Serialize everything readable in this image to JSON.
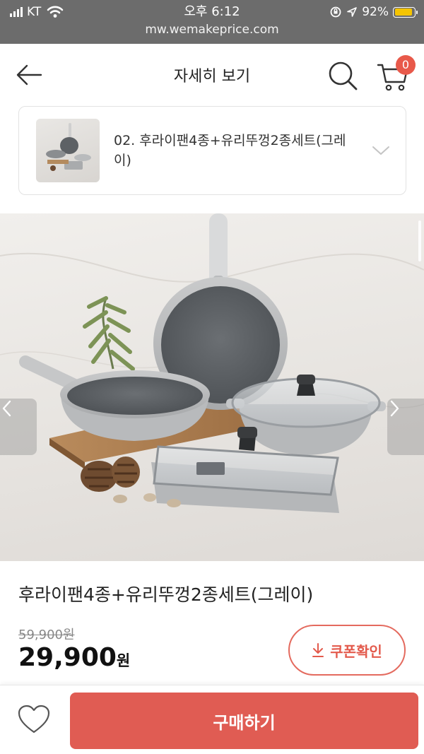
{
  "status_bar": {
    "carrier": "KT",
    "time": "오후 6:12",
    "battery": "92%",
    "url": "mw.wemakeprice.com"
  },
  "header": {
    "title": "자세히 보기",
    "cart_count": "0"
  },
  "option": {
    "label": "02. 후라이팬4종+유리뚜껑2종세트(그레이)"
  },
  "product": {
    "name": "후라이팬4종+유리뚜껑2종세트(그레이)",
    "original_price": "59,900원",
    "sale_price": "29,900",
    "sale_currency": "원",
    "coupon_label": "쿠폰확인"
  },
  "bottom_bar": {
    "buy_label": "구매하기"
  },
  "colors": {
    "accent": "#e05c53",
    "coupon_text": "#e35a4c",
    "badge": "#e8594a",
    "status_bar": "#6c6c6c"
  },
  "icons": {
    "back": "arrow-left-icon",
    "search": "search-icon",
    "cart": "cart-icon",
    "chevron": "chevron-down-icon",
    "prev": "chevron-left-icon",
    "next": "chevron-right-icon",
    "download": "download-icon",
    "like": "heart-icon"
  }
}
